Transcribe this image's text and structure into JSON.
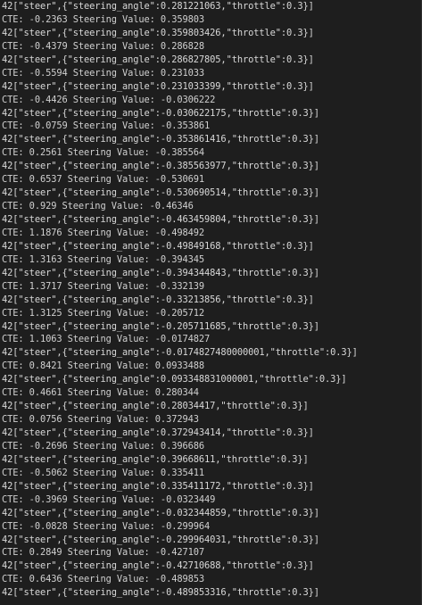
{
  "terminal": {
    "lines": [
      "42[\"steer\",{\"steering_angle\":0.281221063,\"throttle\":0.3}]",
      "CTE: -0.2363 Steering Value: 0.359803",
      "42[\"steer\",{\"steering_angle\":0.359803426,\"throttle\":0.3}]",
      "CTE: -0.4379 Steering Value: 0.286828",
      "42[\"steer\",{\"steering_angle\":0.286827805,\"throttle\":0.3}]",
      "CTE: -0.5594 Steering Value: 0.231033",
      "42[\"steer\",{\"steering_angle\":0.231033399,\"throttle\":0.3}]",
      "CTE: -0.4426 Steering Value: -0.0306222",
      "42[\"steer\",{\"steering_angle\":-0.030622175,\"throttle\":0.3}]",
      "CTE: -0.0759 Steering Value: -0.353861",
      "42[\"steer\",{\"steering_angle\":-0.353861416,\"throttle\":0.3}]",
      "CTE: 0.2561 Steering Value: -0.385564",
      "42[\"steer\",{\"steering_angle\":-0.385563977,\"throttle\":0.3}]",
      "CTE: 0.6537 Steering Value: -0.530691",
      "42[\"steer\",{\"steering_angle\":-0.530690514,\"throttle\":0.3}]",
      "CTE: 0.929 Steering Value: -0.46346",
      "42[\"steer\",{\"steering_angle\":-0.463459804,\"throttle\":0.3}]",
      "CTE: 1.1876 Steering Value: -0.498492",
      "42[\"steer\",{\"steering_angle\":-0.49849168,\"throttle\":0.3}]",
      "CTE: 1.3163 Steering Value: -0.394345",
      "42[\"steer\",{\"steering_angle\":-0.394344843,\"throttle\":0.3}]",
      "CTE: 1.3717 Steering Value: -0.332139",
      "42[\"steer\",{\"steering_angle\":-0.33213856,\"throttle\":0.3}]",
      "CTE: 1.3125 Steering Value: -0.205712",
      "42[\"steer\",{\"steering_angle\":-0.205711685,\"throttle\":0.3}]",
      "CTE: 1.1063 Steering Value: -0.0174827",
      "42[\"steer\",{\"steering_angle\":-0.0174827480000001,\"throttle\":0.3}]",
      "CTE: 0.8421 Steering Value: 0.0933488",
      "42[\"steer\",{\"steering_angle\":0.093348831000001,\"throttle\":0.3}]",
      "CTE: 0.4661 Steering Value: 0.280344",
      "42[\"steer\",{\"steering_angle\":0.28034417,\"throttle\":0.3}]",
      "CTE: 0.0756 Steering Value: 0.372943",
      "42[\"steer\",{\"steering_angle\":0.372943414,\"throttle\":0.3}]",
      "CTE: -0.2696 Steering Value: 0.396686",
      "42[\"steer\",{\"steering_angle\":0.39668611,\"throttle\":0.3}]",
      "CTE: -0.5062 Steering Value: 0.335411",
      "42[\"steer\",{\"steering_angle\":0.335411172,\"throttle\":0.3}]",
      "CTE: -0.3969 Steering Value: -0.0323449",
      "42[\"steer\",{\"steering_angle\":-0.032344859,\"throttle\":0.3}]",
      "CTE: -0.0828 Steering Value: -0.299964",
      "42[\"steer\",{\"steering_angle\":-0.299964031,\"throttle\":0.3}]",
      "CTE: 0.2849 Steering Value: -0.427107",
      "42[\"steer\",{\"steering_angle\":-0.42710688,\"throttle\":0.3}]",
      "CTE: 0.6436 Steering Value: -0.489853",
      "42[\"steer\",{\"steering_angle\":-0.489853316,\"throttle\":0.3}]"
    ]
  }
}
